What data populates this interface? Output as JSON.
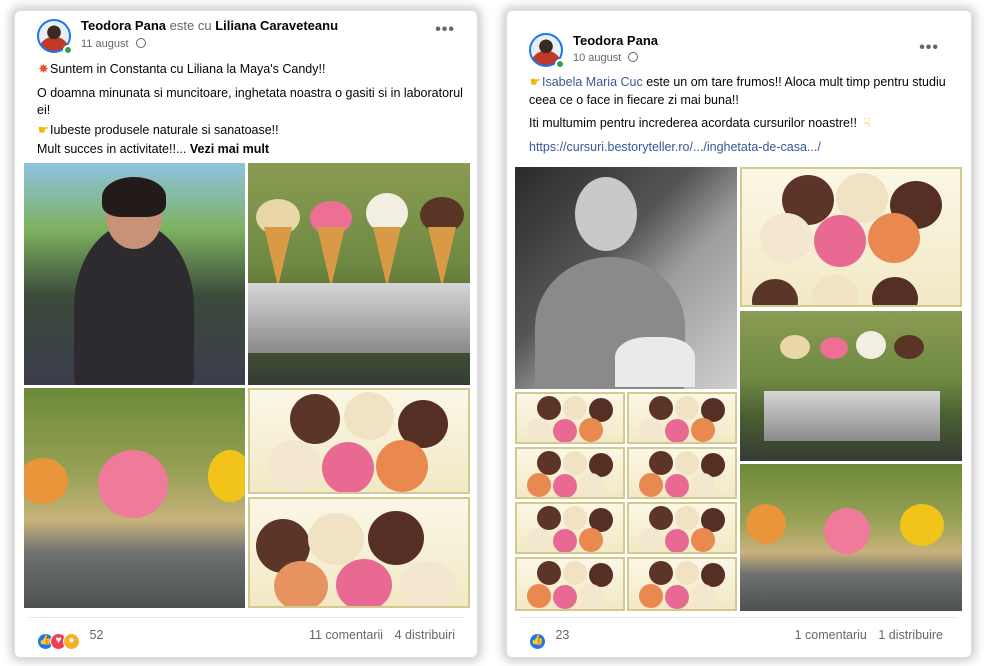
{
  "post1": {
    "author": "Teodora Pana",
    "with_text": "este cu",
    "tagged": "Liliana Caraveteanu",
    "date": "11 august",
    "more": "•••",
    "lines": [
      "Suntem in Constanta cu Liliana la Maya's Candy!!",
      "O doamna minunata si muncitoare, inghetata noastra o gasiti si in laboratorul ei!",
      "Iubeste produsele naturale si sanatoase!!",
      "Mult succes in activitate!!..."
    ],
    "see_more": "Vezi mai mult",
    "reactions_count": "52",
    "comments": "11 comentarii",
    "shares": "4 distribuiri"
  },
  "post2": {
    "author": "Teodora Pana",
    "date": "10 august",
    "more": "•••",
    "mention": "Isabela Maria Cuc",
    "line1_rest": " este un om tare frumos!! Aloca mult timp pentru studiu ceea ce o face in fiecare zi mai buna!!",
    "line2": "Iti multumim pentru increderea acordata cursurilor noastre!!",
    "url": "https://cursuri.bestoryteller.ro/.../inghetata-de-casa.../",
    "reactions_count": "23",
    "comments": "1 comentariu",
    "shares": "1 distribuire"
  },
  "colors": {
    "accent": "#1877f2",
    "link": "#385898",
    "muted": "#65676b",
    "online": "#31a24c"
  },
  "icons": {
    "globe": "globe-icon",
    "more": "more-horizontal-icon",
    "like": "like-reaction-icon",
    "love": "love-reaction-icon",
    "wow": "wow-reaction-icon",
    "point_right": "pointing-hand-icon",
    "burst": "collision-emoji-icon"
  }
}
